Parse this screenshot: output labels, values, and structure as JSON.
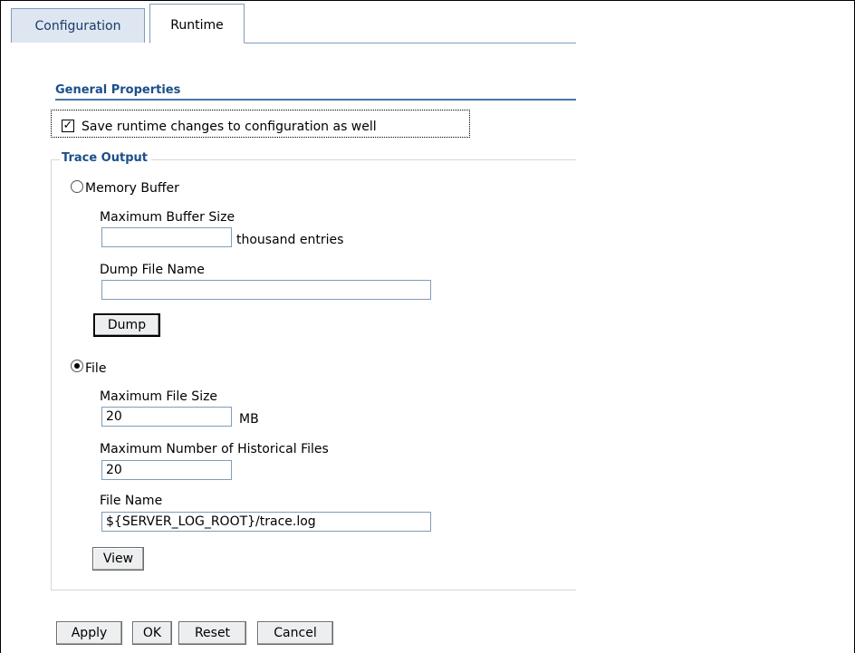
{
  "tabs": [
    {
      "label": "Configuration",
      "active": false
    },
    {
      "label": "Runtime",
      "active": true
    }
  ],
  "section": {
    "title": "General Properties"
  },
  "save_runtime": {
    "label": "Save runtime changes to configuration as well",
    "checked": true
  },
  "trace_output": {
    "legend": "Trace Output",
    "memory_buffer": {
      "label": "Memory Buffer",
      "selected": false,
      "max_buffer_size": {
        "label": "Maximum Buffer Size",
        "value": "",
        "unit": "thousand entries"
      },
      "dump_file_name": {
        "label": "Dump File Name",
        "value": ""
      },
      "dump_button": "Dump"
    },
    "file": {
      "label": "File",
      "selected": true,
      "max_file_size": {
        "label": "Maximum File Size",
        "value": "20",
        "unit": "MB"
      },
      "max_historical_files": {
        "label": "Maximum Number of Historical Files",
        "value": "20"
      },
      "file_name": {
        "label": "File Name",
        "value": "${SERVER_LOG_ROOT}/trace.log"
      },
      "view_button": "View"
    }
  },
  "actions": {
    "apply": "Apply",
    "ok": "OK",
    "reset": "Reset",
    "cancel": "Cancel"
  },
  "colors": {
    "accent": "#1a4f8a",
    "tab_border": "#7d9bbf",
    "input_border": "#7f9db9"
  }
}
